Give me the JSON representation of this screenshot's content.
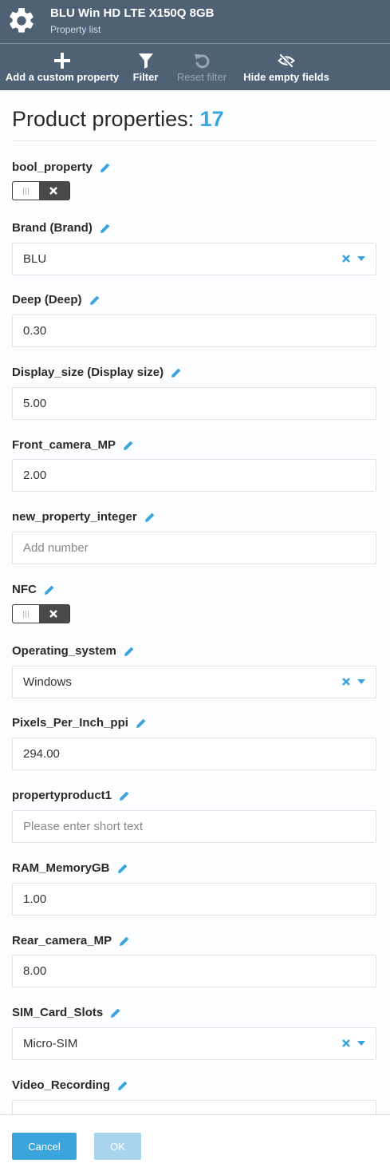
{
  "header": {
    "title": "BLU Win HD LTE X150Q 8GB",
    "subtitle": "Property list",
    "icon": "gear-icon"
  },
  "toolbar": {
    "add_label": "Add a custom property",
    "filter_label": "Filter",
    "reset_label": "Reset filter",
    "hide_label": "Hide empty fields"
  },
  "main": {
    "heading": "Product properties:",
    "count": "17"
  },
  "properties": {
    "bool_property": {
      "label": "bool_property",
      "state": "off"
    },
    "brand": {
      "label": "Brand (Brand)",
      "value": "BLU"
    },
    "deep": {
      "label": "Deep (Deep)",
      "value": "0.30"
    },
    "display_size": {
      "label": "Display_size (Display size)",
      "value": "5.00"
    },
    "front_camera": {
      "label": "Front_camera_MP",
      "value": "2.00"
    },
    "new_property_integer": {
      "label": "new_property_integer",
      "placeholder": "Add number"
    },
    "nfc": {
      "label": "NFC",
      "state": "off"
    },
    "operating_system": {
      "label": "Operating_system",
      "value": "Windows"
    },
    "ppi": {
      "label": "Pixels_Per_Inch_ppi",
      "value": "294.00"
    },
    "propertyproduct1": {
      "label": "propertyproduct1",
      "placeholder": "Please enter short text"
    },
    "ram": {
      "label": "RAM_MemoryGB",
      "value": "1.00"
    },
    "rear_camera": {
      "label": "Rear_camera_MP",
      "value": "8.00"
    },
    "sim": {
      "label": "SIM_Card_Slots",
      "value": "Micro-SIM"
    },
    "video_recording": {
      "label": "Video_Recording",
      "value": ""
    }
  },
  "footer": {
    "cancel_label": "Cancel",
    "ok_label": "OK"
  },
  "colors": {
    "header_bg": "#4e6175",
    "accent": "#3aa4dc",
    "ok_disabled": "#a9d4ee"
  }
}
